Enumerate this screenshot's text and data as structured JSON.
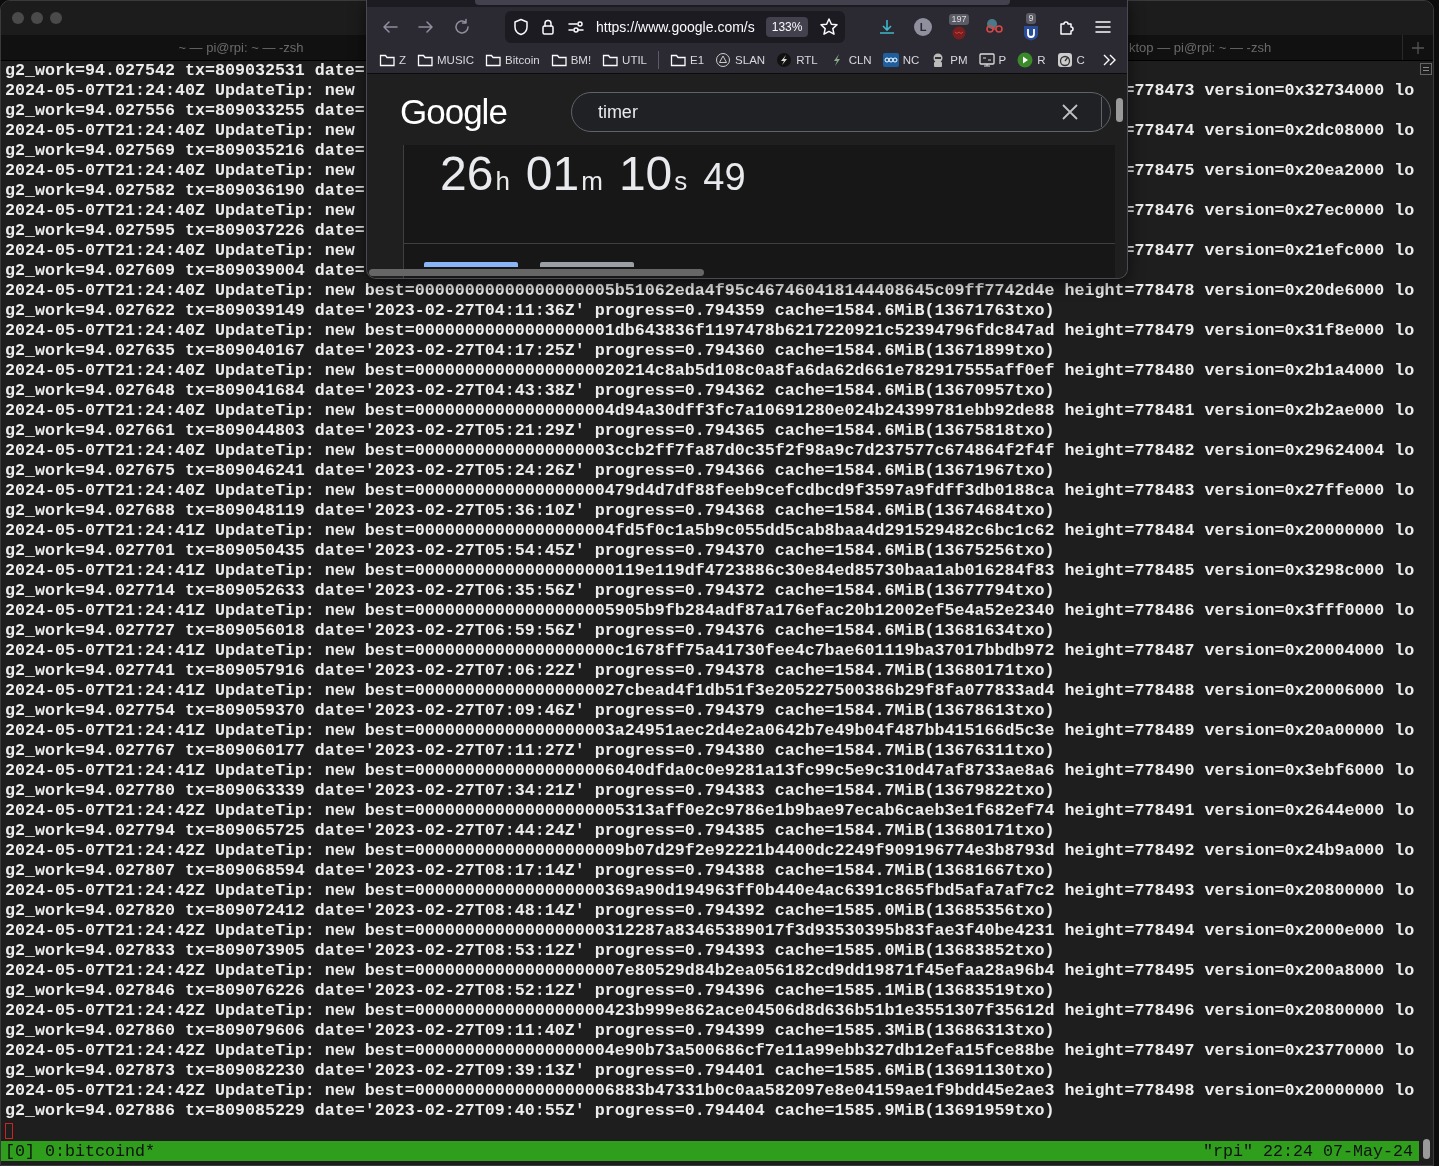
{
  "terminal": {
    "tabs": [
      {
        "title": "~ — pi@rpi: ~ — -zsh"
      },
      {
        "title": "ktop — pi@rpi: ~ — -zsh"
      }
    ],
    "lines": [
      {
        "kind": "split",
        "left": "g2_work=94.027542 tx=809032531 date="
      },
      {
        "kind": "split",
        "left": "2024-05-07T21:24:40Z UpdateTip: new",
        "right": "=778473 version=0x32734000 lo"
      },
      {
        "kind": "split",
        "left": "g2_work=94.027556 tx=809033255 date="
      },
      {
        "kind": "split",
        "left": "2024-05-07T21:24:40Z UpdateTip: new",
        "right": "=778474 version=0x2dc08000 lo"
      },
      {
        "kind": "split",
        "left": "g2_work=94.027569 tx=809035216 date="
      },
      {
        "kind": "split",
        "left": "2024-05-07T21:24:40Z UpdateTip: new",
        "right": "=778475 version=0x20ea2000 lo"
      },
      {
        "kind": "split",
        "left": "g2_work=94.027582 tx=809036190 date="
      },
      {
        "kind": "split",
        "left": "2024-05-07T21:24:40Z UpdateTip: new",
        "right": "=778476 version=0x27ec0000 lo"
      },
      {
        "kind": "split",
        "left": "g2_work=94.027595 tx=809037226 date="
      },
      {
        "kind": "split",
        "left": "2024-05-07T21:24:40Z UpdateTip: new",
        "right": "=778477 version=0x21efc000 lo"
      },
      {
        "kind": "split",
        "left": "g2_work=94.027609 tx=809039004 date="
      },
      {
        "kind": "full",
        "text": "2024-05-07T21:24:40Z UpdateTip: new best=00000000000000000005b51062eda4f95c467460418144408645c09ff7742d4e height=778478 version=0x20de6000 lo"
      },
      {
        "kind": "full",
        "text": "g2_work=94.027622 tx=809039149 date='2023-02-27T04:11:36Z' progress=0.794359 cache=1584.6MiB(13671763txo)"
      },
      {
        "kind": "full",
        "text": "2024-05-07T21:24:40Z UpdateTip: new best=00000000000000000001db643836f1197478b6217220921c52394796fdc847ad height=778479 version=0x31f8e000 lo"
      },
      {
        "kind": "full",
        "text": "g2_work=94.027635 tx=809040167 date='2023-02-27T04:17:25Z' progress=0.794360 cache=1584.6MiB(13671899txo)"
      },
      {
        "kind": "full",
        "text": "2024-05-07T21:24:40Z UpdateTip: new best=000000000000000000020214c8ab5d108c0a8fa6da62d661e782917555aff0ef height=778480 version=0x2b1a4000 lo"
      },
      {
        "kind": "full",
        "text": "g2_work=94.027648 tx=809041684 date='2023-02-27T04:43:38Z' progress=0.794362 cache=1584.6MiB(13670957txo)"
      },
      {
        "kind": "full",
        "text": "2024-05-07T21:24:40Z UpdateTip: new best=00000000000000000004d94a30dff3fc7a10691280e024b24399781ebb92de88 height=778481 version=0x2b2ae000 lo"
      },
      {
        "kind": "full",
        "text": "g2_work=94.027661 tx=809044803 date='2023-02-27T05:21:29Z' progress=0.794365 cache=1584.6MiB(13675818txo)"
      },
      {
        "kind": "full",
        "text": "2024-05-07T21:24:40Z UpdateTip: new best=00000000000000000003ccb2ff7fa87d0c35f2f98a9c7d237577c674864f2f4f height=778482 version=0x29624004 lo"
      },
      {
        "kind": "full",
        "text": "g2_work=94.027675 tx=809046241 date='2023-02-27T05:24:26Z' progress=0.794366 cache=1584.6MiB(13671967txo)"
      },
      {
        "kind": "full",
        "text": "2024-05-07T21:24:40Z UpdateTip: new best=0000000000000000000479d4d7df88feeb9cefcdbcd9f3597a9fdff3db0188ca height=778483 version=0x27ffe000 lo"
      },
      {
        "kind": "full",
        "text": "g2_work=94.027688 tx=809048119 date='2023-02-27T05:36:10Z' progress=0.794368 cache=1584.6MiB(13674684txo)"
      },
      {
        "kind": "full",
        "text": "2024-05-07T21:24:41Z UpdateTip: new best=00000000000000000004fd5f0c1a5b9c055dd5cab8baa4d291529482c6bc1c62 height=778484 version=0x20000000 lo"
      },
      {
        "kind": "full",
        "text": "g2_work=94.027701 tx=809050435 date='2023-02-27T05:54:45Z' progress=0.794370 cache=1584.6MiB(13675256txo)"
      },
      {
        "kind": "full",
        "text": "2024-05-07T21:24:41Z UpdateTip: new best=00000000000000000000119e119df4723886c30e84ed85730baa1ab016284f83 height=778485 version=0x3298c000 lo"
      },
      {
        "kind": "full",
        "text": "g2_work=94.027714 tx=809052633 date='2023-02-27T06:35:56Z' progress=0.794372 cache=1584.6MiB(13677794txo)"
      },
      {
        "kind": "full",
        "text": "2024-05-07T21:24:41Z UpdateTip: new best=00000000000000000005905b9fb284adf87a176efac20b12002ef5e4a52e2340 height=778486 version=0x3fff0000 lo"
      },
      {
        "kind": "full",
        "text": "g2_work=94.027727 tx=809056018 date='2023-02-27T06:59:56Z' progress=0.794376 cache=1584.6MiB(13681634txo)"
      },
      {
        "kind": "full",
        "text": "2024-05-07T21:24:41Z UpdateTip: new best=00000000000000000000c1678ff75a41730fee4c7bae601119ba37017bbdb972 height=778487 version=0x20004000 lo"
      },
      {
        "kind": "full",
        "text": "g2_work=94.027741 tx=809057916 date='2023-02-27T07:06:22Z' progress=0.794378 cache=1584.7MiB(13680171txo)"
      },
      {
        "kind": "full",
        "text": "2024-05-07T21:24:41Z UpdateTip: new best=000000000000000000027cbead4f1db51f3e205227500386b29f8fa077833ad4 height=778488 version=0x20006000 lo"
      },
      {
        "kind": "full",
        "text": "g2_work=94.027754 tx=809059370 date='2023-02-27T07:09:46Z' progress=0.794379 cache=1584.7MiB(13678613txo)"
      },
      {
        "kind": "full",
        "text": "2024-05-07T21:24:41Z UpdateTip: new best=00000000000000000003a24951aec2d4e2a0642b7e49b04f487bb415166d5c3e height=778489 version=0x20a00000 lo"
      },
      {
        "kind": "full",
        "text": "g2_work=94.027767 tx=809060177 date='2023-02-27T07:11:27Z' progress=0.794380 cache=1584.7MiB(13676311txo)"
      },
      {
        "kind": "full",
        "text": "2024-05-07T21:24:41Z UpdateTip: new best=00000000000000000006040dfda0c0e9281a13fc99c5e9c310d47af8733ae8a6 height=778490 version=0x3ebf6000 lo"
      },
      {
        "kind": "full",
        "text": "g2_work=94.027780 tx=809063339 date='2023-02-27T07:34:21Z' progress=0.794383 cache=1584.7MiB(13679822txo)"
      },
      {
        "kind": "full",
        "text": "2024-05-07T21:24:42Z UpdateTip: new best=000000000000000000005313aff0e2c9786e1b9bae97ecab6caeb3e1f682ef74 height=778491 version=0x2644e000 lo"
      },
      {
        "kind": "full",
        "text": "g2_work=94.027794 tx=809065725 date='2023-02-27T07:44:24Z' progress=0.794385 cache=1584.7MiB(13680171txo)"
      },
      {
        "kind": "full",
        "text": "2024-05-07T21:24:42Z UpdateTip: new best=000000000000000000009b07d29f2e92221b4400dc2249f909196774e3b8793d height=778492 version=0x24b9a000 lo"
      },
      {
        "kind": "full",
        "text": "g2_work=94.027807 tx=809068594 date='2023-02-27T08:17:14Z' progress=0.794388 cache=1584.7MiB(13681667txo)"
      },
      {
        "kind": "full",
        "text": "2024-05-07T21:24:42Z UpdateTip: new best=0000000000000000000369a90d194963ff0b440e4ac6391c865fbd5afa7af7c2 height=778493 version=0x20800000 lo"
      },
      {
        "kind": "full",
        "text": "g2_work=94.027820 tx=809072412 date='2023-02-27T08:48:14Z' progress=0.794392 cache=1585.0MiB(13685356txo)"
      },
      {
        "kind": "full",
        "text": "2024-05-07T21:24:42Z UpdateTip: new best=0000000000000000000312287a83465389017f3d93530395b83fae3f40be4231 height=778494 version=0x2000e000 lo"
      },
      {
        "kind": "full",
        "text": "g2_work=94.027833 tx=809073905 date='2023-02-27T08:53:12Z' progress=0.794393 cache=1585.0MiB(13683852txo)"
      },
      {
        "kind": "full",
        "text": "2024-05-07T21:24:42Z UpdateTip: new best=000000000000000000007e80529d84b2ea056182cd9dd19871f45efaa28a96b4 height=778495 version=0x200a8000 lo"
      },
      {
        "kind": "full",
        "text": "g2_work=94.027846 tx=809076226 date='2023-02-27T08:52:12Z' progress=0.794396 cache=1585.1MiB(13683519txo)"
      },
      {
        "kind": "full",
        "text": "2024-05-07T21:24:42Z UpdateTip: new best=0000000000000000000423b999e862ace04506d8d636b51b1e3551307f35612d height=778496 version=0x20800000 lo"
      },
      {
        "kind": "full",
        "text": "g2_work=94.027860 tx=809079606 date='2023-02-27T09:11:40Z' progress=0.794399 cache=1585.3MiB(13686313txo)"
      },
      {
        "kind": "full",
        "text": "2024-05-07T21:24:42Z UpdateTip: new best=00000000000000000004e90b73a500686cf7e11a99ebb327db12efa15fce88be height=778497 version=0x23770000 lo"
      },
      {
        "kind": "full",
        "text": "g2_work=94.027873 tx=809082230 date='2023-02-27T09:39:13Z' progress=0.794401 cache=1585.6MiB(13691130txo)"
      },
      {
        "kind": "full",
        "text": "2024-05-07T21:24:42Z UpdateTip: new best=00000000000000000006883b47331b0c0aa582097e8e04159ae1f9bdd45e2ae3 height=778498 version=0x20000000 lo"
      },
      {
        "kind": "full",
        "text": "g2_work=94.027886 tx=809085229 date='2023-02-27T09:40:55Z' progress=0.794404 cache=1585.9MiB(13691959txo)"
      }
    ],
    "status_bar": {
      "left": "[0] 0:bitcoind*",
      "right": "\"rpi\" 22:24 07-May-24"
    }
  },
  "browser": {
    "url": "https://www.google.com/s",
    "zoom": "133%",
    "toolbar": [
      {
        "kind": "download"
      },
      {
        "kind": "avatar",
        "text": "L"
      },
      {
        "kind": "extension",
        "badge": "197"
      },
      {
        "kind": "glasses"
      },
      {
        "kind": "shield",
        "badge": "9"
      },
      {
        "kind": "puzzle"
      },
      {
        "kind": "menu"
      }
    ],
    "bookmarks": [
      {
        "kind": "folder",
        "label": "Z"
      },
      {
        "kind": "folder",
        "label": "MUSIC"
      },
      {
        "kind": "folder",
        "label": "Bitcoin"
      },
      {
        "kind": "folder",
        "label": "BM!"
      },
      {
        "kind": "folder",
        "label": "UTIL"
      },
      {
        "kind": "separator"
      },
      {
        "kind": "folder",
        "label": "E1"
      },
      {
        "kind": "triangle",
        "label": "SLAN"
      },
      {
        "kind": "bolt-circle",
        "label": "RTL"
      },
      {
        "kind": "bolt",
        "label": "CLN"
      },
      {
        "kind": "rings",
        "label": "NC"
      },
      {
        "kind": "helmet",
        "label": "PM"
      },
      {
        "kind": "monitor",
        "label": "P"
      },
      {
        "kind": "play",
        "label": "R"
      },
      {
        "kind": "gauge",
        "label": "C"
      }
    ],
    "page": {
      "logo": "Google",
      "search": {
        "value": "timer"
      },
      "timer": [
        {
          "value": "26",
          "unit": "h"
        },
        {
          "value": "01",
          "unit": "m"
        },
        {
          "value": "10",
          "unit": "s"
        },
        {
          "value": "49"
        }
      ],
      "timer_tabs": [
        {
          "selected": true
        },
        {
          "selected": false
        }
      ]
    }
  }
}
